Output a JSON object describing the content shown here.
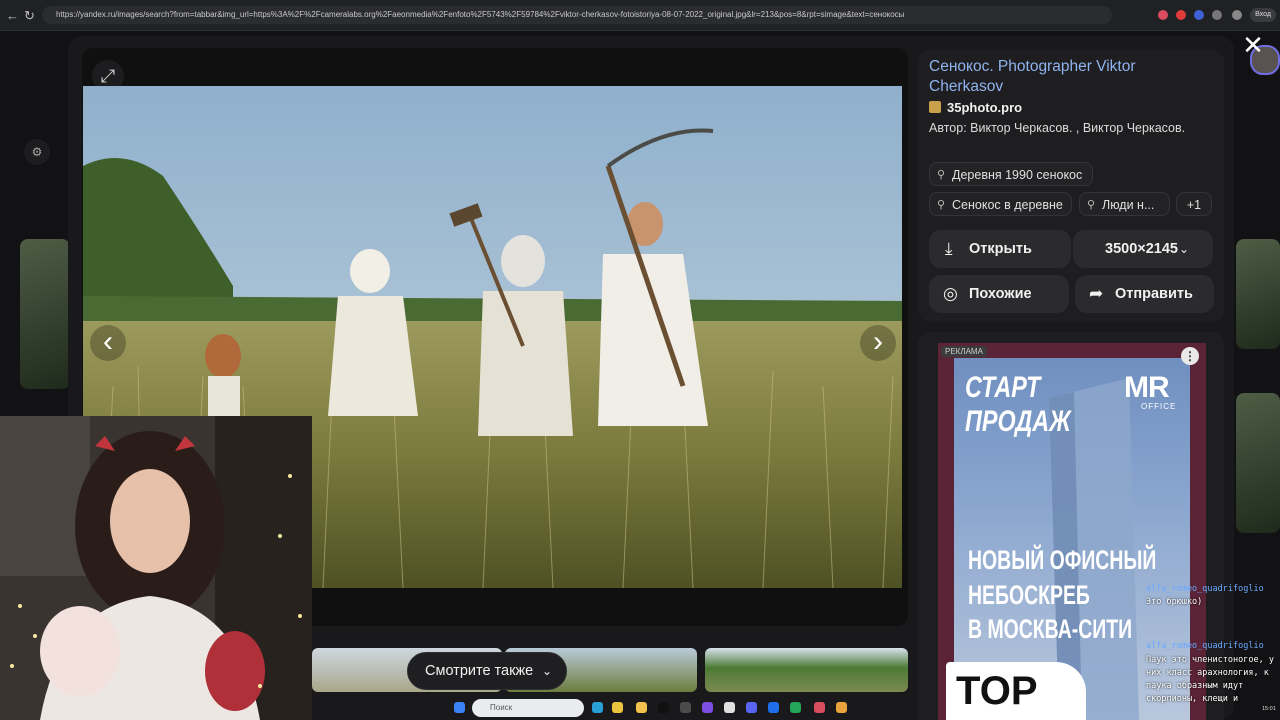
{
  "browser": {
    "url": "https://yandex.ru/images/search?from=tabbar&img_url=https%3A%2F%2Fcameralabs.org%2Faeonmedia%2Fenfoto%2F5743%2F59784%2Fviktor-cherkasov-fotoistoriya-08-07-2022_original.jpg&lr=213&pos=8&rpt=simage&text=сенокосы",
    "profile_label": "Вход"
  },
  "viewer": {
    "expand_icon": "⤢",
    "prev_icon": "‹",
    "next_icon": "›",
    "close_icon": "✕"
  },
  "info": {
    "title": "Сенокос. Photographer Viktor Cherkasov",
    "source": "35photo.pro",
    "author": "Автор: Виктор Черкасов. , Виктор Черкасов.",
    "tags": [
      "Деревня 1990 сенокос",
      "Сенокос в деревне",
      "Люди н...",
      "+1"
    ],
    "open_label": "Открыть",
    "size_label": "3500×2145",
    "similar_label": "Похожие",
    "share_label": "Отправить"
  },
  "ad": {
    "badge": "РЕКЛАМА",
    "headline_1": "СТАРТ",
    "headline_2": "ПРОДАЖ",
    "logo": "MR",
    "logo_sub": "OFFICE",
    "body_1": "НОВЫЙ ОФИСНЫЙ",
    "body_2": "НЕБОСКРЕБ",
    "body_3": "В МОСКВА-СИТИ",
    "bottom": "TOP"
  },
  "see_also": {
    "label": "Смотрите также"
  },
  "chat": [
    {
      "name": "alfa_romeo_quadrifoglio",
      "text": "Это брюшко)"
    },
    {
      "name": "alfa_romeo_quadrifoglio",
      "text": "Паук это членистоногое, у них класс арахнология, к паука образным идут скорпионы, клещи и"
    }
  ],
  "taskbar": {
    "search_placeholder": "Поиск",
    "clock": "15:01"
  },
  "colors": {
    "accent_link": "#8fb3ee",
    "modal_bg": "#19191b",
    "ad_bg": "#5a2336"
  }
}
